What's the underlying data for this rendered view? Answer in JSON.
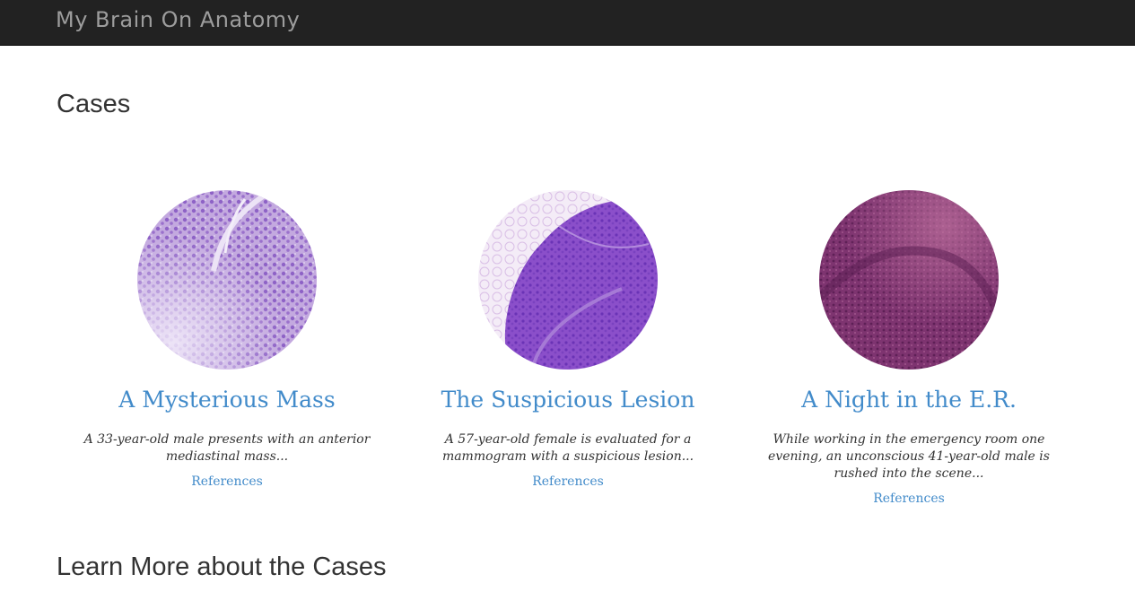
{
  "navbar": {
    "brand": "My Brain On Anatomy"
  },
  "cases_section": {
    "title": "Cases"
  },
  "cases": [
    {
      "title": "A Mysterious Mass",
      "description": "A 33-year-old male presents with an anterior mediastinal mass...",
      "references_label": "References",
      "image_palette": [
        "#b79ad6",
        "#8a5fc2",
        "#f3eefa"
      ]
    },
    {
      "title": "The Suspicious Lesion",
      "description": "A 57-year-old female is evaluated for a mammogram with a suspicious lesion...",
      "references_label": "References",
      "image_palette": [
        "#8a4fc8",
        "#6a35b5",
        "#e9dcf0"
      ]
    },
    {
      "title": "A Night in the E.R.",
      "description": "While working in the emergency room one evening, an unconscious 41-year-old male is rushed into the scene...",
      "references_label": "References",
      "image_palette": [
        "#8e3f78",
        "#6a2660",
        "#b86a96"
      ]
    }
  ],
  "learn_section": {
    "title": "Learn More about the Cases"
  },
  "colors": {
    "navbar_bg": "#222222",
    "brand_text": "#9d9d9d",
    "link": "#428bca",
    "heading": "#333333"
  }
}
